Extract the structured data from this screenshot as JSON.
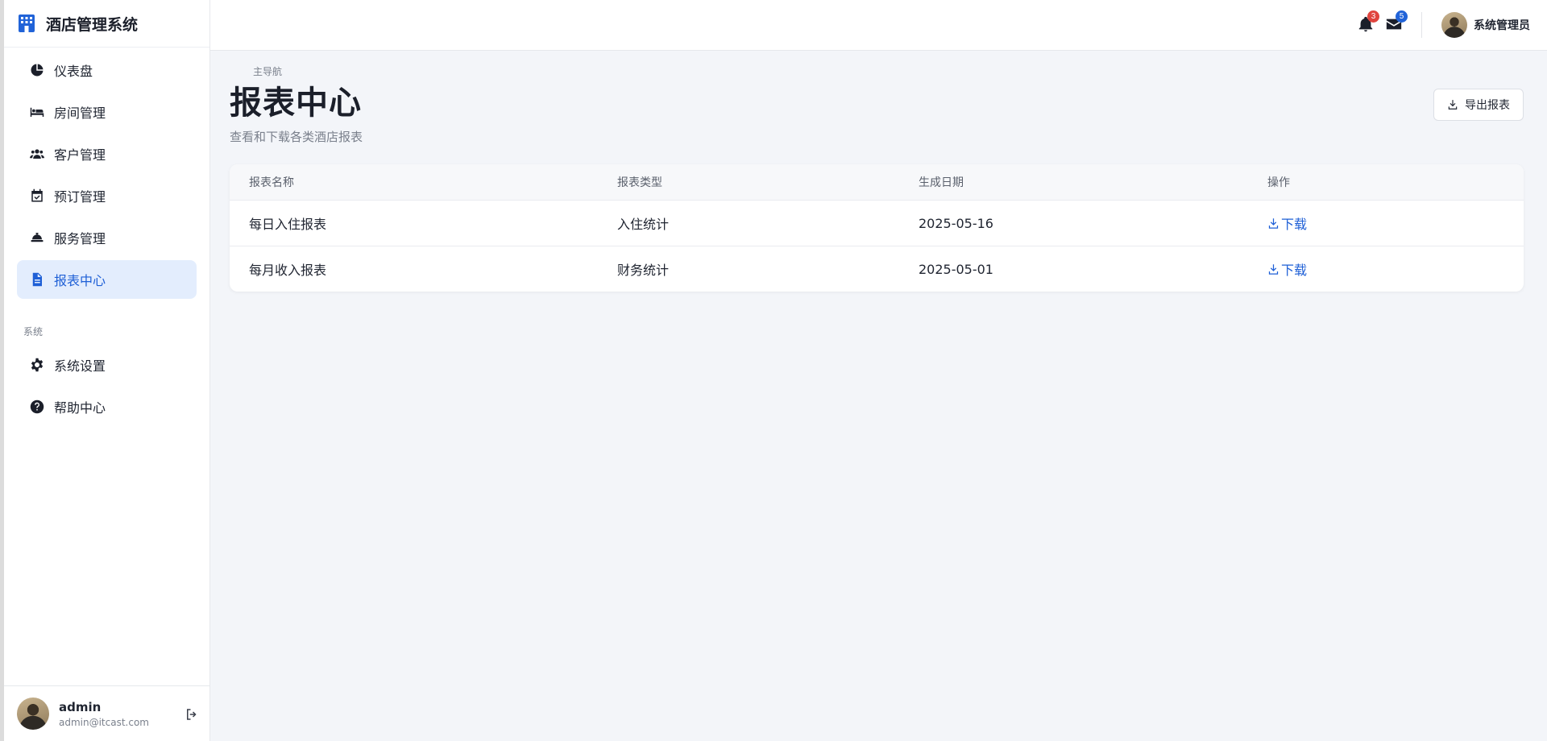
{
  "app": {
    "title": "酒店管理系统"
  },
  "sidebar": {
    "section_main": "主导航",
    "section_system": "系统",
    "items": [
      {
        "label": "仪表盘",
        "icon": "chart-pie-icon"
      },
      {
        "label": "房间管理",
        "icon": "bed-icon"
      },
      {
        "label": "客户管理",
        "icon": "users-icon"
      },
      {
        "label": "预订管理",
        "icon": "calendar-check-icon"
      },
      {
        "label": "服务管理",
        "icon": "concierge-bell-icon"
      },
      {
        "label": "报表中心",
        "icon": "file-icon",
        "active": true
      }
    ],
    "system_items": [
      {
        "label": "系统设置",
        "icon": "gear-icon"
      },
      {
        "label": "帮助中心",
        "icon": "help-circle-icon"
      }
    ],
    "user": {
      "name": "admin",
      "email": "admin@itcast.com"
    }
  },
  "topbar": {
    "notifications_count": "3",
    "messages_count": "5",
    "user_name": "系统管理员"
  },
  "page": {
    "title": "报表中心",
    "subtitle": "查看和下载各类酒店报表",
    "export_label": "导出报表"
  },
  "table": {
    "headers": [
      "报表名称",
      "报表类型",
      "生成日期",
      "操作"
    ],
    "rows": [
      {
        "name": "每日入住报表",
        "type": "入住统计",
        "date": "2025-05-16",
        "action": "下载"
      },
      {
        "name": "每月收入报表",
        "type": "财务统计",
        "date": "2025-05-01",
        "action": "下载"
      }
    ]
  },
  "colors": {
    "accent": "#1e5fd6",
    "badge_red": "#e0443e",
    "badge_blue": "#2163d8",
    "active_bg": "#e3edfd"
  }
}
